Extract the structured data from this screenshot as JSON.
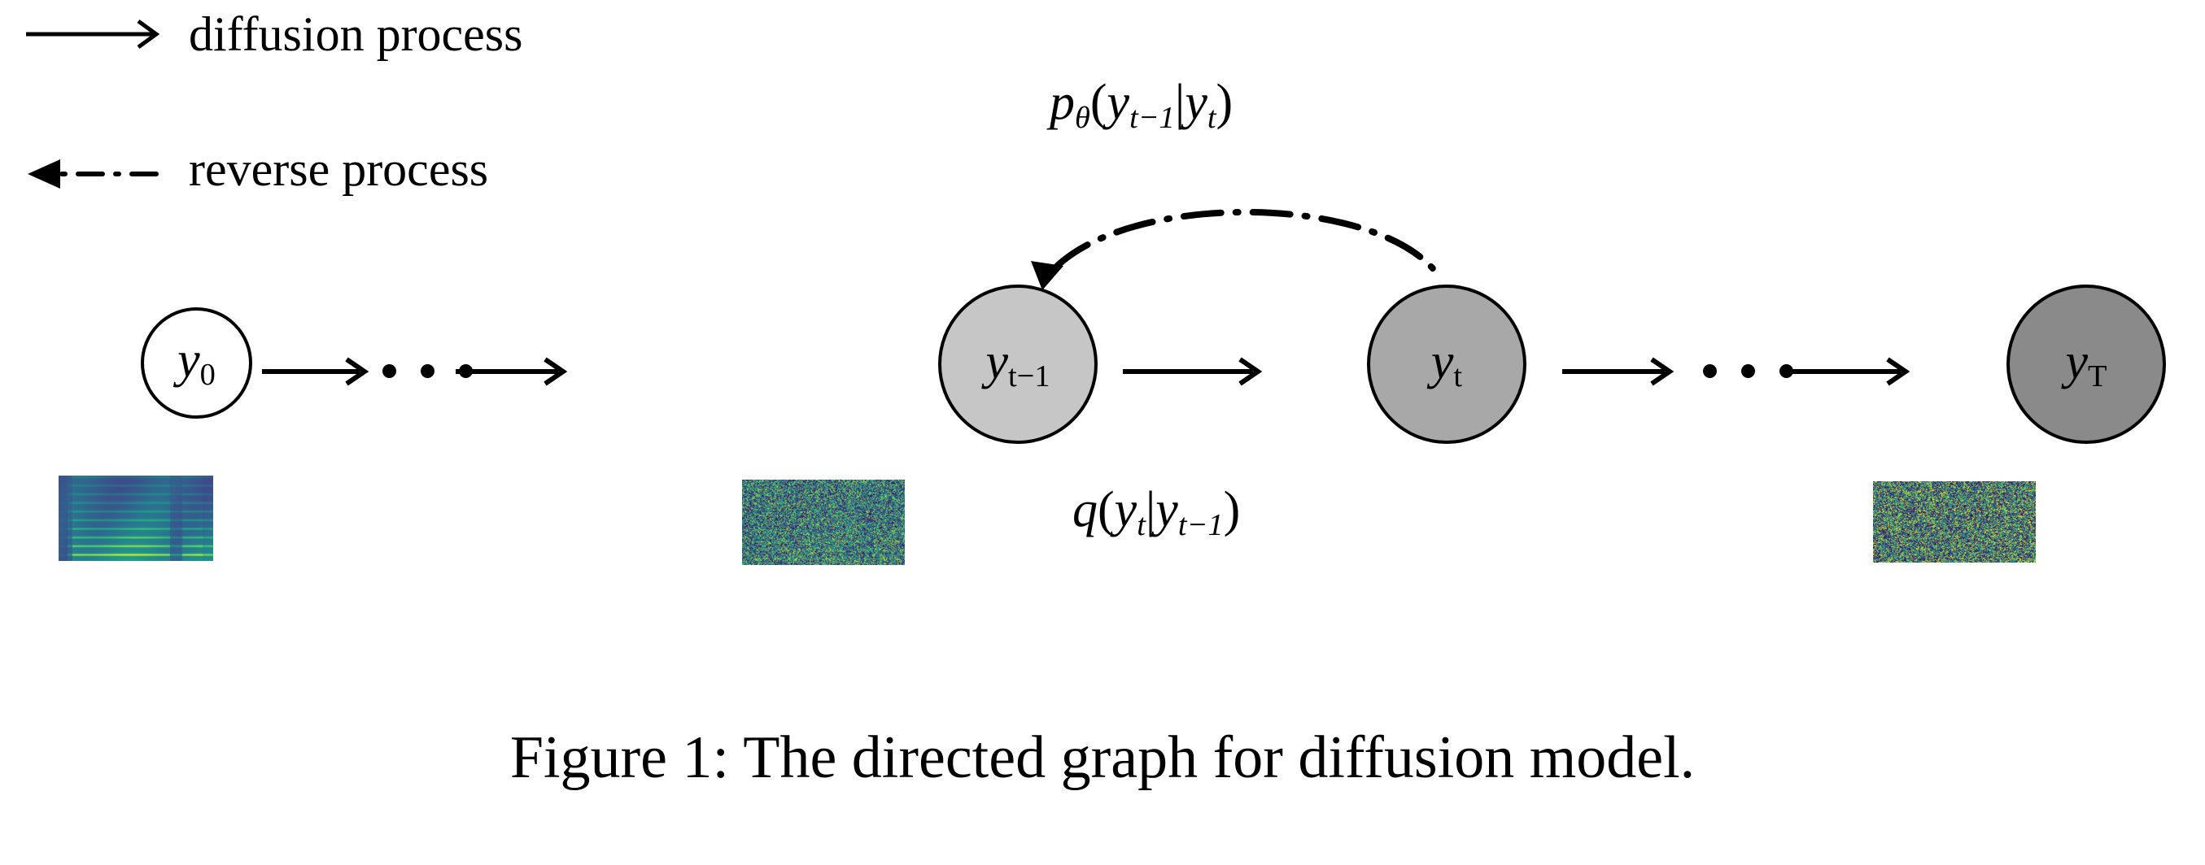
{
  "figure": {
    "caption": "Figure 1: The directed graph for diffusion model."
  },
  "legend": {
    "items": [
      {
        "label": "diffusion process",
        "icon": "solid-arrow-right-icon",
        "style": "solid"
      },
      {
        "label": "reverse process",
        "icon": "dashdot-arrow-left-icon",
        "style": "dash-dot"
      }
    ]
  },
  "formulas": {
    "reverse": {
      "fn": "p",
      "sub": "θ",
      "open": "(",
      "target": "y",
      "target_sub": "t−1",
      "bar": "|",
      "cond": "y",
      "cond_sub": "t",
      "close": ")",
      "plain": "pθ(y t−1|y t)"
    },
    "forward": {
      "fn": "q",
      "open": "(",
      "target": "y",
      "target_sub": "t",
      "bar": "|",
      "cond": "y",
      "cond_sub": "t−1",
      "close": ")",
      "plain": "q(y t|y t−1)"
    }
  },
  "graph": {
    "nodes": [
      {
        "id": "y0",
        "var": "y",
        "sub": "0",
        "fill": "#ffffff",
        "stroke": "#000000"
      },
      {
        "id": "ytm1",
        "var": "y",
        "sub": "t−1",
        "fill": "#c6c6c6",
        "stroke": "#000000"
      },
      {
        "id": "yt",
        "var": "y",
        "sub": "t",
        "fill": "#a8a8a8",
        "stroke": "#000000"
      },
      {
        "id": "yT",
        "var": "y",
        "sub": "T",
        "fill": "#8a8a8a",
        "stroke": "#000000"
      }
    ],
    "edges": [
      {
        "from": "y0",
        "to": "ellipsis1",
        "kind": "solid-arrow"
      },
      {
        "from": "ellipsis1",
        "to": "ytm1",
        "kind": "solid-arrow"
      },
      {
        "from": "ytm1",
        "to": "yt",
        "kind": "solid-arrow"
      },
      {
        "from": "yt",
        "to": "ellipsis2",
        "kind": "solid-arrow"
      },
      {
        "from": "ellipsis2",
        "to": "yT",
        "kind": "solid-arrow"
      },
      {
        "from": "yt",
        "to": "ytm1",
        "kind": "dashdot-arc-arrow"
      }
    ],
    "ellipsis_count": 3
  },
  "spectrograms": [
    {
      "id": "spec-y0",
      "kind": "clean-harmonics",
      "noise": 0.0,
      "colormap": "viridis"
    },
    {
      "id": "spec-ytm1",
      "kind": "noisy-residual",
      "noise": 0.82,
      "colormap": "viridis"
    },
    {
      "id": "spec-yT",
      "kind": "pure-noise",
      "noise": 1.0,
      "colormap": "viridis"
    }
  ],
  "colors": {
    "ink": "#000000",
    "background": "#ffffff",
    "node_white": "#ffffff",
    "node_light_gray": "#c6c6c6",
    "node_mid_gray": "#a8a8a8",
    "node_dark_gray": "#8a8a8a"
  }
}
